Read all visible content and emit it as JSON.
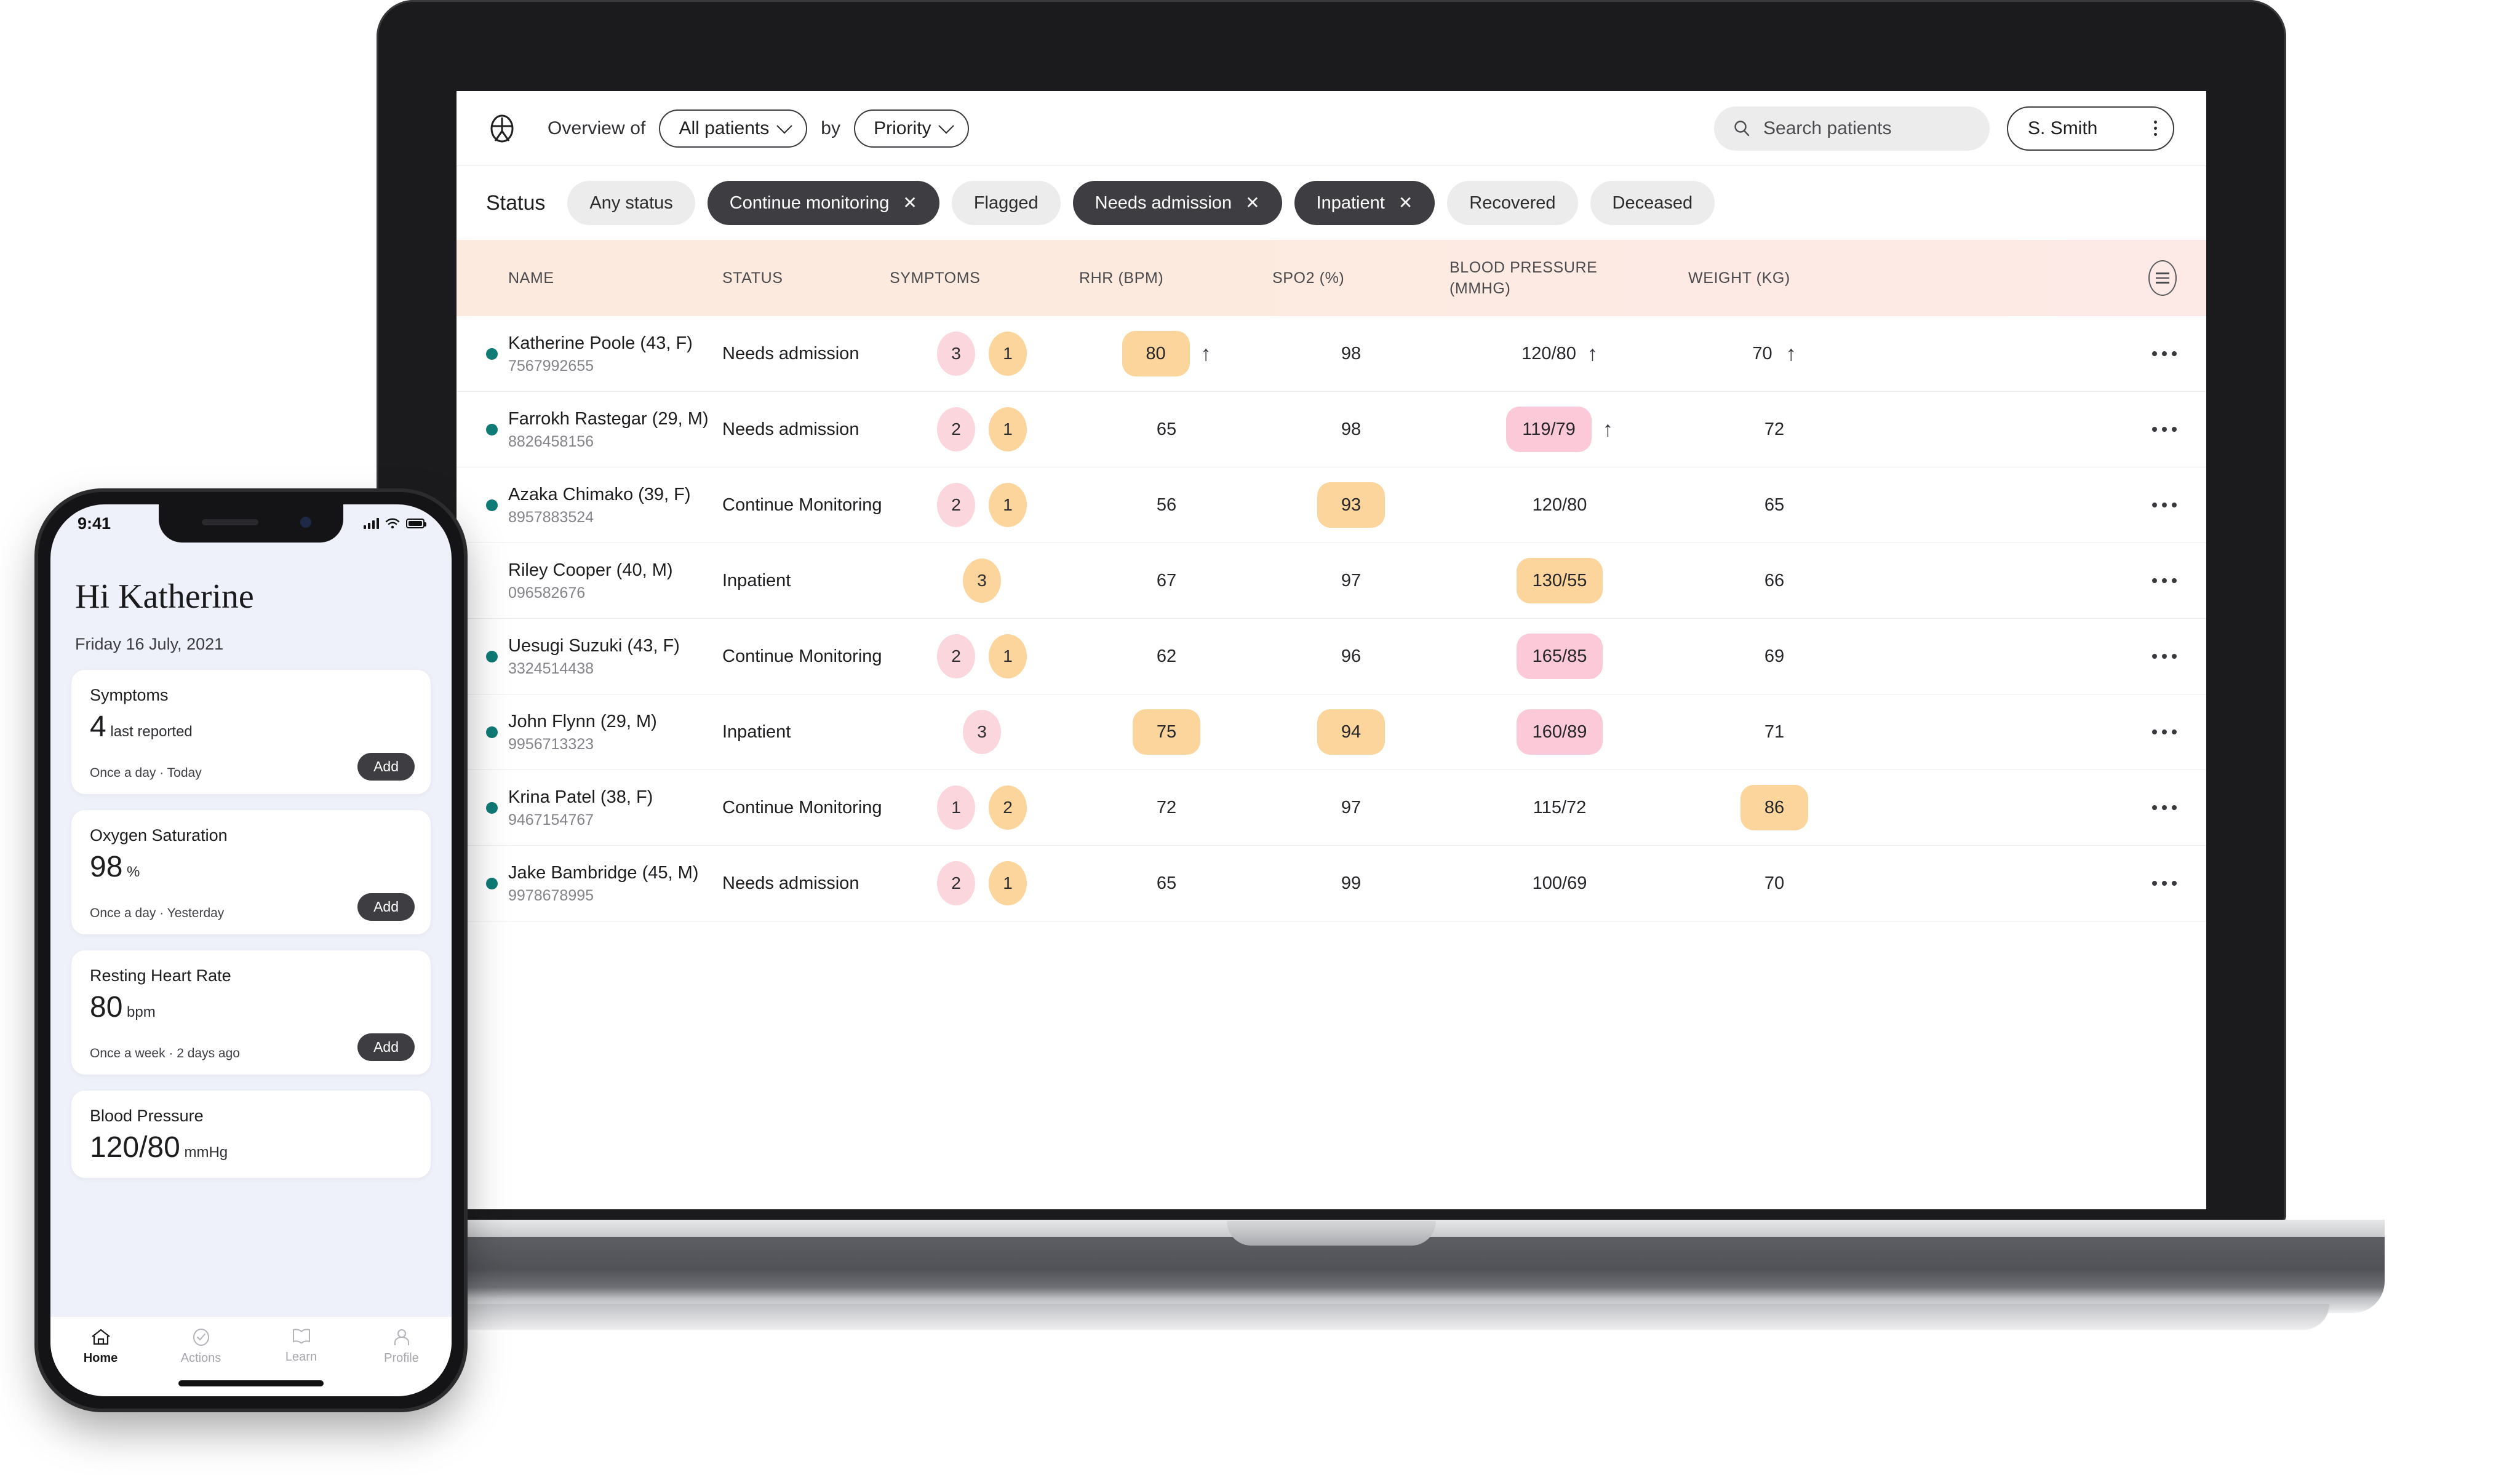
{
  "app": {
    "header": {
      "brand_icon": "person-in-circle-icon",
      "overview_label": "Overview of",
      "patients_filter": "All patients",
      "by_label": "by",
      "sort_filter": "Priority",
      "search_placeholder": "Search patients",
      "search_value": "",
      "search_icon": "search-icon",
      "user_name": "S. Smith",
      "user_menu_icon": "kebab-menu-icon"
    },
    "status_filter": {
      "label": "Status",
      "chips": [
        {
          "label": "Any status",
          "selected": false,
          "removable": false
        },
        {
          "label": "Continue monitoring",
          "selected": true,
          "removable": true,
          "remove_icon": "close-icon"
        },
        {
          "label": "Flagged",
          "selected": false,
          "removable": false
        },
        {
          "label": "Needs admission",
          "selected": true,
          "removable": true,
          "remove_icon": "close-icon"
        },
        {
          "label": "Inpatient",
          "selected": true,
          "removable": true,
          "remove_icon": "close-icon"
        },
        {
          "label": "Recovered",
          "selected": false,
          "removable": false
        },
        {
          "label": "Deceased",
          "selected": false,
          "removable": false
        }
      ]
    },
    "table": {
      "columns": {
        "name": "NAME",
        "status": "STATUS",
        "symptoms": "SYMPTOMS",
        "rhr": "RHR (BPM)",
        "spo2": "SPO2 (%)",
        "blood_pressure_line1": "BLOOD PRESSURE",
        "blood_pressure_line2": "(MMHG)",
        "weight": "WEIGHT (KG)",
        "settings_icon": "list-settings-icon"
      },
      "row_menu_icon": "more-horizontal-icon",
      "rows": [
        {
          "online": true,
          "name": "Katherine Poole (43, F)",
          "id": "7567992655",
          "status": "Needs admission",
          "symptoms": [
            {
              "value": "3",
              "color": "pink"
            },
            {
              "value": "1",
              "color": "orange"
            }
          ],
          "rhr": {
            "value": "80",
            "highlight": "orange",
            "trend": "up"
          },
          "spo2": {
            "value": "98",
            "highlight": "none",
            "trend": "none"
          },
          "bp": {
            "value": "120/80",
            "highlight": "none",
            "trend": "up"
          },
          "weight": {
            "value": "70",
            "highlight": "none",
            "trend": "up"
          }
        },
        {
          "online": true,
          "name": "Farrokh Rastegar (29, M)",
          "id": "8826458156",
          "status": "Needs admission",
          "symptoms": [
            {
              "value": "2",
              "color": "pink"
            },
            {
              "value": "1",
              "color": "orange"
            }
          ],
          "rhr": {
            "value": "65",
            "highlight": "none",
            "trend": "none"
          },
          "spo2": {
            "value": "98",
            "highlight": "none",
            "trend": "none"
          },
          "bp": {
            "value": "119/79",
            "highlight": "pink",
            "trend": "up"
          },
          "weight": {
            "value": "72",
            "highlight": "none",
            "trend": "none"
          }
        },
        {
          "online": true,
          "name": "Azaka Chimako (39, F)",
          "id": "8957883524",
          "status": "Continue Monitoring",
          "symptoms": [
            {
              "value": "2",
              "color": "pink"
            },
            {
              "value": "1",
              "color": "orange"
            }
          ],
          "rhr": {
            "value": "56",
            "highlight": "none",
            "trend": "none"
          },
          "spo2": {
            "value": "93",
            "highlight": "orange",
            "trend": "none"
          },
          "bp": {
            "value": "120/80",
            "highlight": "none",
            "trend": "none"
          },
          "weight": {
            "value": "65",
            "highlight": "none",
            "trend": "none"
          }
        },
        {
          "online": false,
          "name": "Riley Cooper (40, M)",
          "id": "096582676",
          "status": "Inpatient",
          "symptoms": [
            {
              "value": "3",
              "color": "orange"
            }
          ],
          "rhr": {
            "value": "67",
            "highlight": "none",
            "trend": "none"
          },
          "spo2": {
            "value": "97",
            "highlight": "none",
            "trend": "none"
          },
          "bp": {
            "value": "130/55",
            "highlight": "orange",
            "trend": "none"
          },
          "weight": {
            "value": "66",
            "highlight": "none",
            "trend": "none"
          }
        },
        {
          "online": true,
          "name": "Uesugi Suzuki (43, F)",
          "id": "3324514438",
          "status": "Continue Monitoring",
          "symptoms": [
            {
              "value": "2",
              "color": "pink"
            },
            {
              "value": "1",
              "color": "orange"
            }
          ],
          "rhr": {
            "value": "62",
            "highlight": "none",
            "trend": "none"
          },
          "spo2": {
            "value": "96",
            "highlight": "none",
            "trend": "none"
          },
          "bp": {
            "value": "165/85",
            "highlight": "pink",
            "trend": "none"
          },
          "weight": {
            "value": "69",
            "highlight": "none",
            "trend": "none"
          }
        },
        {
          "online": true,
          "name": "John Flynn (29, M)",
          "id": "9956713323",
          "status": "Inpatient",
          "symptoms": [
            {
              "value": "3",
              "color": "pink"
            }
          ],
          "rhr": {
            "value": "75",
            "highlight": "orange",
            "trend": "none"
          },
          "spo2": {
            "value": "94",
            "highlight": "orange",
            "trend": "none"
          },
          "bp": {
            "value": "160/89",
            "highlight": "pink",
            "trend": "none"
          },
          "weight": {
            "value": "71",
            "highlight": "none",
            "trend": "none"
          }
        },
        {
          "online": true,
          "name": "Krina Patel (38, F)",
          "id": "9467154767",
          "status": "Continue Monitoring",
          "symptoms": [
            {
              "value": "1",
              "color": "pink"
            },
            {
              "value": "2",
              "color": "orange"
            }
          ],
          "rhr": {
            "value": "72",
            "highlight": "none",
            "trend": "none"
          },
          "spo2": {
            "value": "97",
            "highlight": "none",
            "trend": "none"
          },
          "bp": {
            "value": "115/72",
            "highlight": "none",
            "trend": "none"
          },
          "weight": {
            "value": "86",
            "highlight": "orange",
            "trend": "none"
          }
        },
        {
          "online": true,
          "name": "Jake Bambridge (45, M)",
          "id": "9978678995",
          "status": "Needs admission",
          "symptoms": [
            {
              "value": "2",
              "color": "pink"
            },
            {
              "value": "1",
              "color": "orange"
            }
          ],
          "rhr": {
            "value": "65",
            "highlight": "none",
            "trend": "none"
          },
          "spo2": {
            "value": "99",
            "highlight": "none",
            "trend": "none"
          },
          "bp": {
            "value": "100/69",
            "highlight": "none",
            "trend": "none"
          },
          "weight": {
            "value": "70",
            "highlight": "none",
            "trend": "none"
          }
        }
      ]
    }
  },
  "phone": {
    "status_bar": {
      "time": "9:41",
      "signal_icon": "cellular-bars-icon",
      "wifi_icon": "wifi-icon",
      "battery_icon": "battery-icon"
    },
    "greeting": "Hi Katherine",
    "date": "Friday 16 July, 2021",
    "cards": [
      {
        "title": "Symptoms",
        "value": "4",
        "unit": "last reported",
        "meta": "Once a day · Today",
        "action": "Add"
      },
      {
        "title": "Oxygen Saturation",
        "value": "98",
        "unit": "%",
        "meta": "Once a day · Yesterday",
        "action": "Add"
      },
      {
        "title": "Resting Heart Rate",
        "value": "80",
        "unit": "bpm",
        "meta": "Once a week · 2 days ago",
        "action": "Add"
      },
      {
        "title": "Blood Pressure",
        "value": "120/80",
        "unit": "mmHg",
        "meta": "",
        "action": ""
      }
    ],
    "tabs": [
      {
        "label": "Home",
        "icon": "home-icon",
        "active": true
      },
      {
        "label": "Actions",
        "icon": "check-circle-icon",
        "active": false
      },
      {
        "label": "Learn",
        "icon": "book-icon",
        "active": false
      },
      {
        "label": "Profile",
        "icon": "person-icon",
        "active": false
      }
    ]
  },
  "colors": {
    "accent_pink": "#fbc9d8",
    "accent_orange": "#fbd59c",
    "header_band": "#fdeade",
    "chip_selected": "#3e3e42",
    "online_dot": "#0f7b75"
  }
}
